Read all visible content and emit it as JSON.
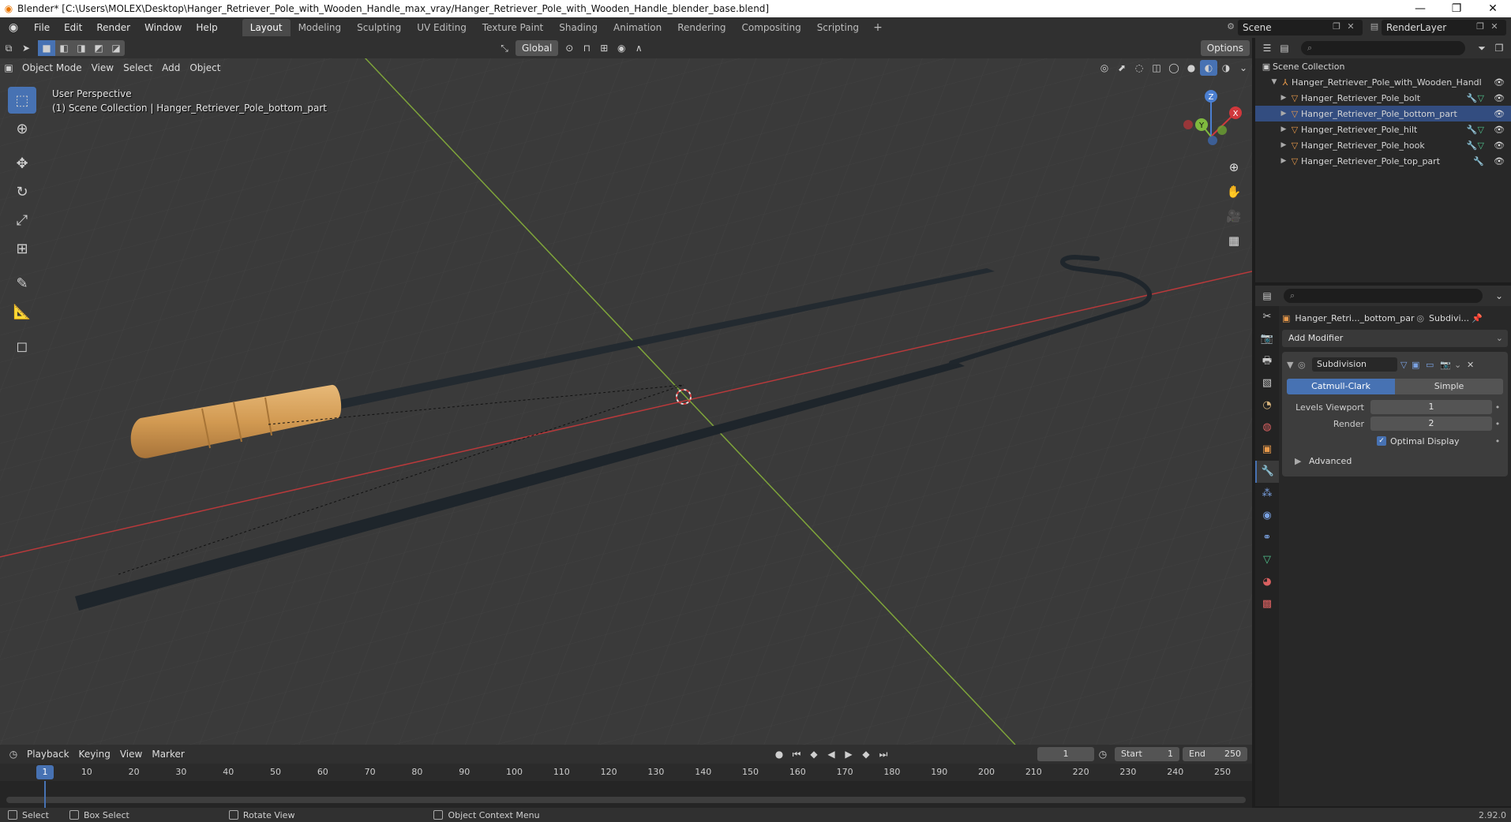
{
  "window": {
    "title": "Blender* [C:\\Users\\MOLEX\\Desktop\\Hanger_Retriever_Pole_with_Wooden_Handle_max_vray/Hanger_Retriever_Pole_with_Wooden_Handle_blender_base.blend]"
  },
  "menu": [
    "File",
    "Edit",
    "Render",
    "Window",
    "Help"
  ],
  "workspaces": [
    "Layout",
    "Modeling",
    "Sculpting",
    "UV Editing",
    "Texture Paint",
    "Shading",
    "Animation",
    "Rendering",
    "Compositing",
    "Scripting"
  ],
  "active_workspace": "Layout",
  "scene": {
    "name": "Scene",
    "view_layer": "RenderLayer"
  },
  "viewport": {
    "orientation": "Global",
    "options_label": "Options",
    "mode": "Object Mode",
    "menus": [
      "View",
      "Select",
      "Add",
      "Object"
    ],
    "info_line1": "User Perspective",
    "info_line2": "(1) Scene Collection | Hanger_Retriever_Pole_bottom_part",
    "gizmo": {
      "x": "X",
      "y": "Y",
      "z": "Z"
    }
  },
  "outliner": {
    "root": "Scene Collection",
    "parent": "Hanger_Retriever_Pole_with_Wooden_Handl",
    "items": [
      {
        "label": "Hanger_Retriever_Pole_bolt",
        "selected": false
      },
      {
        "label": "Hanger_Retriever_Pole_bottom_part",
        "selected": true
      },
      {
        "label": "Hanger_Retriever_Pole_hilt",
        "selected": false
      },
      {
        "label": "Hanger_Retriever_Pole_hook",
        "selected": false
      },
      {
        "label": "Hanger_Retriever_Pole_top_part",
        "selected": false
      }
    ]
  },
  "properties": {
    "object_name": "Hanger_Retri..._bottom_par",
    "modifier_short": "Subdivi...",
    "add_modifier": "Add Modifier",
    "modifier": {
      "name": "Subdivision",
      "type_catmull": "Catmull-Clark",
      "type_simple": "Simple",
      "levels_viewport_label": "Levels Viewport",
      "levels_viewport": "1",
      "render_label": "Render",
      "render": "2",
      "optimal_display": "Optimal Display",
      "optimal_display_checked": true,
      "advanced": "Advanced"
    }
  },
  "timeline": {
    "menus": [
      "Playback",
      "Keying",
      "View",
      "Marker"
    ],
    "current_frame": "1",
    "start_label": "Start",
    "start": "1",
    "end_label": "End",
    "end": "250",
    "ruler_ticks": [
      "10",
      "20",
      "30",
      "40",
      "50",
      "60",
      "70",
      "80",
      "90",
      "100",
      "110",
      "120",
      "130",
      "140",
      "150",
      "160",
      "170",
      "180",
      "190",
      "200",
      "210",
      "220",
      "230",
      "240",
      "250"
    ],
    "ruler_current": "1"
  },
  "status": {
    "select": "Select",
    "box_select": "Box Select",
    "rotate_view": "Rotate View",
    "context_menu": "Object Context Menu",
    "version": "2.92.0"
  },
  "colors": {
    "accent": "#4772b3",
    "x_axis": "#c0393b",
    "y_axis": "#8ab534",
    "wood": "#d8a35a"
  }
}
